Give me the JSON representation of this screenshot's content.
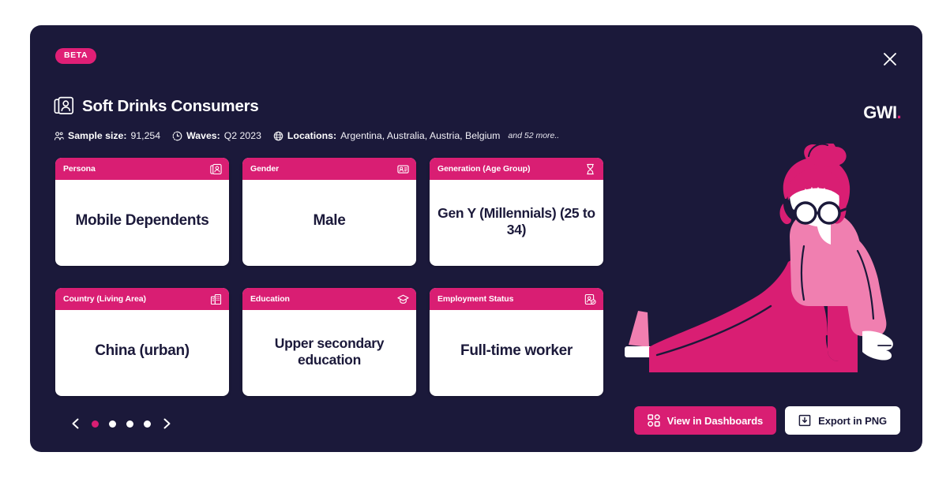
{
  "modal": {
    "beta_badge": "BETA",
    "title": "Soft Drinks Consumers",
    "title_icon": "persona-cards-icon",
    "close_icon": "close-icon",
    "logo": {
      "text": "GWI",
      "dot": ".",
      "accent_color": "#e01f76"
    },
    "background_color": "#1b193a",
    "accent_color": "#d91e73"
  },
  "meta": {
    "sample": {
      "icon": "people-icon",
      "label": "Sample size:",
      "value": "91,254"
    },
    "waves": {
      "icon": "clock-icon",
      "label": "Waves:",
      "value": "Q2 2023"
    },
    "locations": {
      "icon": "globe-icon",
      "label": "Locations:",
      "value": "Argentina, Australia, Austria, Belgium",
      "more": "and 52 more.."
    }
  },
  "cards": [
    {
      "label": "Persona",
      "icon": "persona-cards-icon",
      "value": "Mobile Dependents"
    },
    {
      "label": "Gender",
      "icon": "id-card-icon",
      "value": "Male"
    },
    {
      "label": "Generation (Age Group)",
      "icon": "hourglass-icon",
      "value": "Gen Y (Millennials) (25 to 34)"
    },
    {
      "label": "Country (Living Area)",
      "icon": "building-icon",
      "value": "China (urban)"
    },
    {
      "label": "Education",
      "icon": "graduation-cap-icon",
      "value": "Upper secondary education"
    },
    {
      "label": "Employment Status",
      "icon": "briefcase-badge-icon",
      "value": "Full-time worker"
    }
  ],
  "pagination": {
    "prev_icon": "chevron-left-icon",
    "next_icon": "chevron-right-icon",
    "total_pages": 4,
    "current_page": 1
  },
  "actions": {
    "view_dashboards": {
      "label": "View in Dashboards",
      "icon": "dashboard-grid-icon"
    },
    "export_png": {
      "label": "Export in PNG",
      "icon": "download-icon"
    }
  }
}
